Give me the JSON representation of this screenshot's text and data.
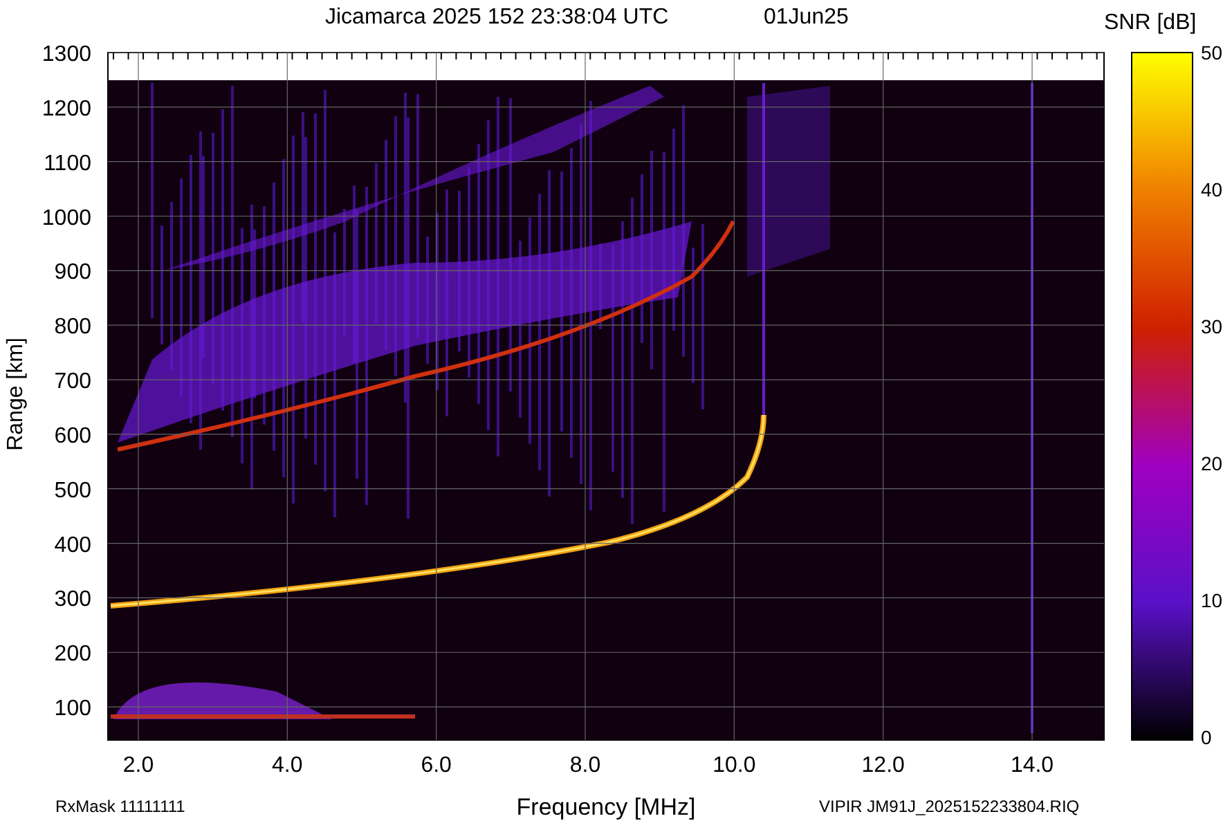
{
  "title": "Jicamarca 2025 152 23:38:04 UTC",
  "date": "01Jun25",
  "plot": {
    "xlabel": "Frequency [MHz]",
    "ylabel": "Range [km]",
    "xticks": [
      "2.0",
      "4.0",
      "6.0",
      "8.0",
      "10.0",
      "12.0",
      "14.0"
    ],
    "yticks": [
      "1300",
      "1200",
      "1100",
      "1000",
      "900",
      "800",
      "700",
      "600",
      "500",
      "400",
      "300",
      "200",
      "100"
    ]
  },
  "colorbar": {
    "label": "SNR [dB]",
    "ticks": [
      "50",
      "40",
      "30",
      "20",
      "10",
      "0"
    ]
  },
  "footer": {
    "left": "RxMask 11111111",
    "right": "VIPIR  JM91J_2025152233804.RIQ"
  }
}
